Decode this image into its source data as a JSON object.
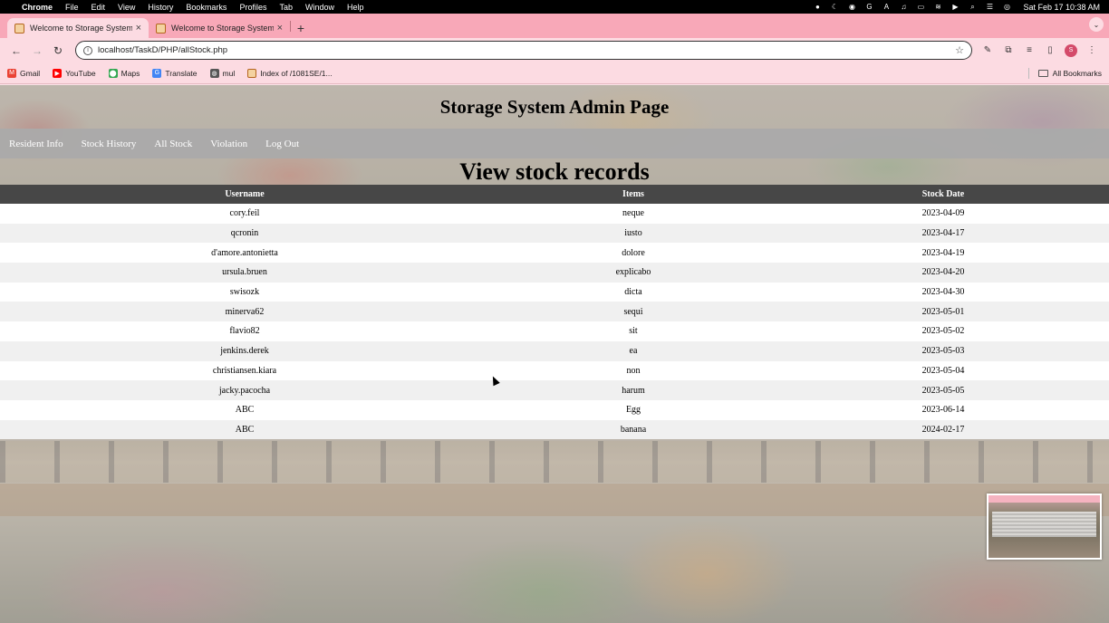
{
  "menubar": {
    "app": "Chrome",
    "items": [
      "File",
      "Edit",
      "View",
      "History",
      "Bookmarks",
      "Profiles",
      "Tab",
      "Window",
      "Help"
    ],
    "clock": "Sat Feb 17  10:38 AM"
  },
  "tabs": [
    {
      "title": "Welcome to Storage System",
      "active": true
    },
    {
      "title": "Welcome to Storage System",
      "active": false
    }
  ],
  "toolbar": {
    "url": "localhost/TaskD/PHP/allStock.php",
    "profile_initial": "S"
  },
  "bookmarks": {
    "items": [
      "Gmail",
      "YouTube",
      "Maps",
      "Translate",
      "mul",
      "Index of /1081SE/1..."
    ],
    "all_label": "All Bookmarks"
  },
  "page": {
    "admin_title": "Storage System Admin Page",
    "nav": [
      "Resident Info",
      "Stock History",
      "All Stock",
      "Violation",
      "Log Out"
    ],
    "section_title": "View stock records",
    "table": {
      "headers": [
        "Username",
        "Items",
        "Stock Date"
      ],
      "rows": [
        [
          "cory.feil",
          "neque",
          "2023-04-09"
        ],
        [
          "qcronin",
          "iusto",
          "2023-04-17"
        ],
        [
          "d'amore.antonietta",
          "dolore",
          "2023-04-19"
        ],
        [
          "ursula.bruen",
          "explicabo",
          "2023-04-20"
        ],
        [
          "swisozk",
          "dicta",
          "2023-04-30"
        ],
        [
          "minerva62",
          "sequi",
          "2023-05-01"
        ],
        [
          "flavio82",
          "sit",
          "2023-05-02"
        ],
        [
          "jenkins.derek",
          "ea",
          "2023-05-03"
        ],
        [
          "christiansen.kiara",
          "non",
          "2023-05-04"
        ],
        [
          "jacky.pacocha",
          "harum",
          "2023-05-05"
        ],
        [
          "ABC",
          "Egg",
          "2023-06-14"
        ],
        [
          "ABC",
          "banana",
          "2024-02-17"
        ]
      ]
    }
  },
  "colors": {
    "tabstrip": "#f8a8b8",
    "toolbar": "#fcdbe2",
    "navbar": "#aaaaaa",
    "table_header": "#474747"
  }
}
